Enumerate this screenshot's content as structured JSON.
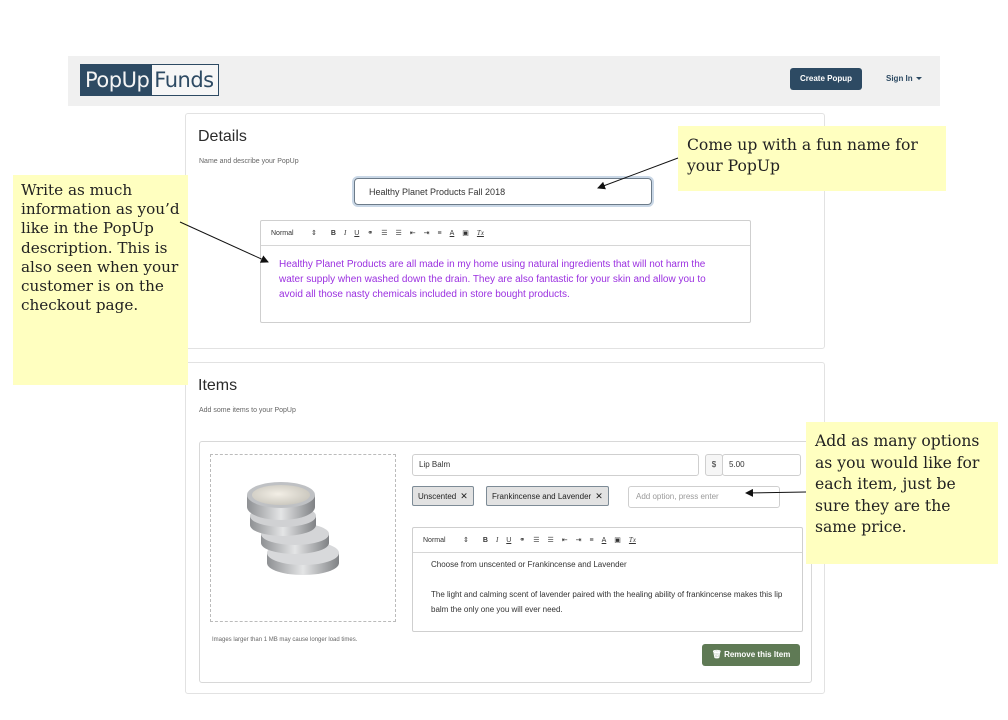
{
  "navbar": {
    "brand_part1": "PopUp",
    "brand_part2": "Funds",
    "create_button": "Create Popup",
    "signin_label": "Sign In"
  },
  "details": {
    "title": "Details",
    "subtitle": "Name and describe your PopUp",
    "name_value": "Healthy Planet Products Fall 2018",
    "editor_toolbar": {
      "style_select": "Normal",
      "bold": "B",
      "italic": "I",
      "underline": "U",
      "clear_format": "Tx"
    },
    "description": "Healthy Planet Products are all made in my home using natural ingredients that will not harm the water supply when washed down the drain. They are also fantastic for your skin and allow you to avoid all those nasty chemicals included in store bought products."
  },
  "items": {
    "title": "Items",
    "subtitle": "Add some items to your PopUp",
    "item": {
      "name_value": "Lip Balm",
      "currency_symbol": "$",
      "price_value": "5.00",
      "options": [
        "Unscented",
        "Frankincense and Lavender"
      ],
      "option_remove_glyph": "✕",
      "option_placeholder": "Add option, press enter",
      "description_line1": "Choose from unscented or Frankincense and Lavender",
      "description_line2": "The light and calming scent of lavender paired with the healing ability of frankincense makes this lip balm the only one you will ever need.",
      "image_note": "Images larger than 1 MB may cause longer load times.",
      "remove_button": "Remove this Item"
    }
  },
  "annotations": {
    "description_note": "Write as much information as you’d like in the PopUp description. This is also seen when your customer is on the checkout page.",
    "name_note": "Come up with a fun name for your PopUp",
    "options_note": "Add as many options as you would like for each item, just be sure they are the same price."
  },
  "colors": {
    "brand": "#2d4a63",
    "description_text": "#9b30e0",
    "remove_button": "#5f7a55",
    "note_background": "#ffffc0"
  }
}
